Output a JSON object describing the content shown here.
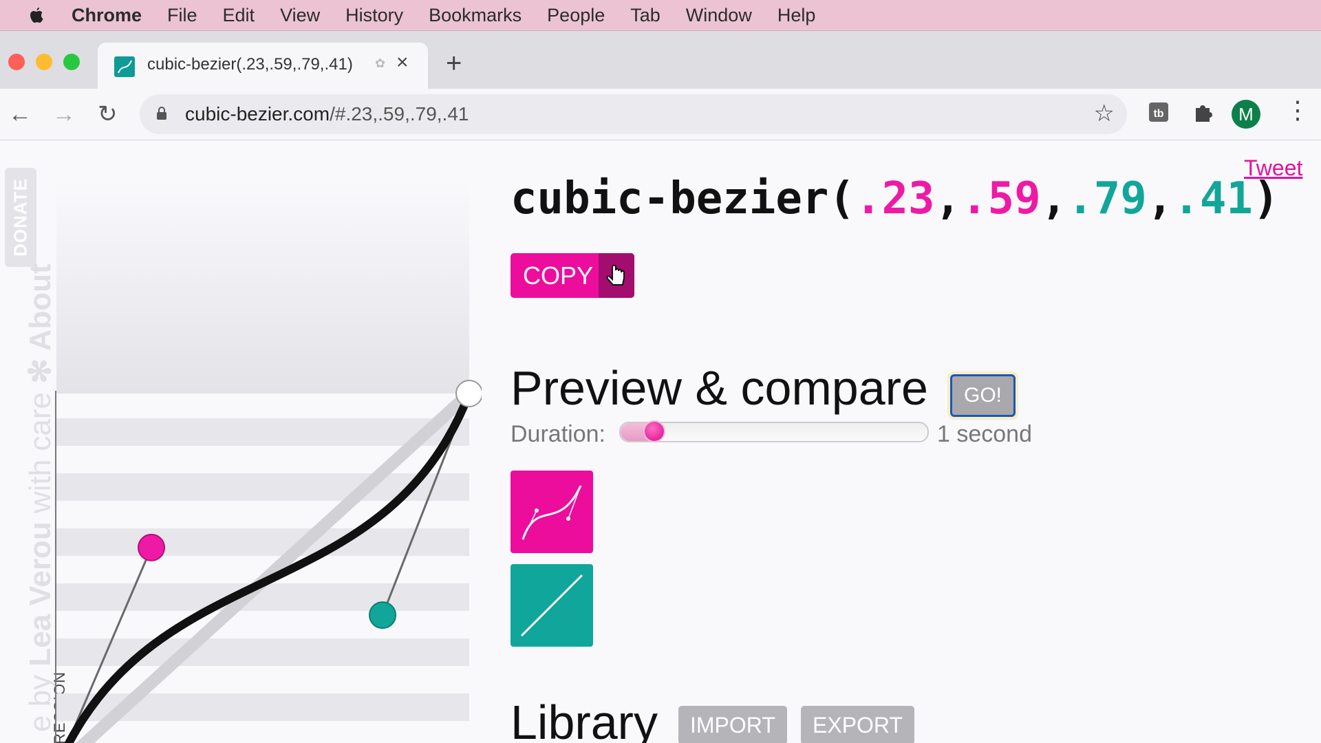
{
  "menubar": {
    "items": [
      "Chrome",
      "File",
      "Edit",
      "View",
      "History",
      "Bookmarks",
      "People",
      "Tab",
      "Window",
      "Help"
    ]
  },
  "tab": {
    "title": "cubic-bezier(.23,.59,.79,.41)"
  },
  "omnibox": {
    "host": "cubic-bezier.com",
    "path": "/#.23,.59,.79,.41"
  },
  "profile": {
    "initial": "M"
  },
  "sidebar": {
    "donate": "DONATE",
    "credit_prefix": "e by ",
    "credit_author": "Lea Verou",
    "credit_suffix": " with care ",
    "about": "About",
    "progression": "RESSION"
  },
  "header": {
    "tweet": "Tweet",
    "fn_prefix": "cubic-bezier(",
    "p1x": ".23",
    "p1y": ".59",
    "p2x": ".79",
    "p2y": ".41",
    "fn_suffix": ")",
    "copy": "COPY"
  },
  "preview": {
    "heading": "Preview & compare",
    "go": "GO!",
    "duration_label": "Duration:",
    "duration_value": "1 second",
    "duration_fraction": 0.11
  },
  "library": {
    "heading": "Library",
    "import": "IMPORT",
    "export": "EXPORT"
  },
  "curve": {
    "p1": [
      0.23,
      0.59
    ],
    "p2": [
      0.79,
      0.41
    ]
  },
  "colors": {
    "accent_pink": "#ec0d9d",
    "accent_teal": "#10a69b"
  }
}
